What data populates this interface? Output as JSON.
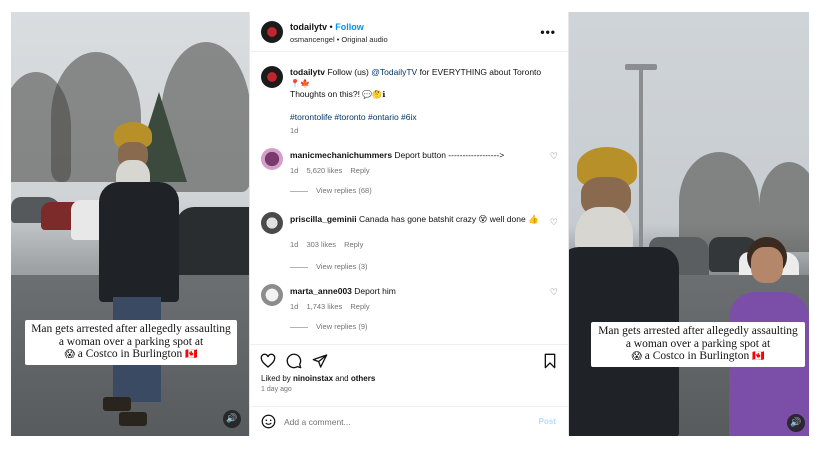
{
  "left_video": {
    "caption_text": "Man gets arrested after allegedly assaulting a woman over a parking spot at",
    "caption_emoji": "😱",
    "caption_text_2": "a Costco in Burlington",
    "caption_flag": "🇨🇦",
    "mute_icon": "speaker-icon"
  },
  "right_video": {
    "caption_text": "Man gets arrested after allegedly assaulting a woman over a parking spot at",
    "caption_emoji": "😱",
    "caption_text_2": "a Costco in Burlington",
    "caption_flag": "🇨🇦",
    "mute_icon": "speaker-icon"
  },
  "post": {
    "header": {
      "username": "todailytv",
      "separator": "•",
      "follow_label": "Follow",
      "audio": "osmancengel • Original audio",
      "more": "•••"
    },
    "caption": {
      "username": "todailytv",
      "text_before_mention": " Follow (us) ",
      "mention": "@TodailyTV",
      "text_after_mention": " for EVERYTHING about Toronto",
      "emojis_line": "📍🍁",
      "question": "Thoughts on this?!",
      "question_emojis": "💬🤔ℹ",
      "hashtags": "#torontolife #toronto #ontario #6ix",
      "time": "1d"
    },
    "comments": [
      {
        "username": "manicmechanichummers",
        "text": "Deport button ------------------>",
        "time": "1d",
        "likes": "5,620 likes",
        "reply": "Reply",
        "view_replies": "View replies (68)"
      },
      {
        "username": "priscilla_geminii",
        "text": "Canada has gone batshit crazy 😵 well done 👍",
        "time": "1d",
        "likes": "303 likes",
        "reply": "Reply",
        "view_replies": "View replies (3)"
      },
      {
        "username": "marta_anne003",
        "text": "Deport him",
        "time": "1d",
        "likes": "1,743 likes",
        "reply": "Reply",
        "view_replies": "View replies (9)"
      }
    ],
    "liked_by_prefix": "Liked by ",
    "liked_by_user": "ninoinstax",
    "liked_by_and": " and ",
    "liked_by_others": "others",
    "date": "1 day ago",
    "comment_placeholder": "Add a comment...",
    "post_button": "Post"
  },
  "icons": {
    "heart": "heart-icon",
    "comment": "comment-icon",
    "share": "share-icon",
    "bookmark": "bookmark-icon",
    "emoji": "emoji-icon",
    "more": "more-icon",
    "mute": "speaker-icon"
  },
  "colors": {
    "follow": "#0095f6",
    "hashtag": "#00376b",
    "muted_text": "#737373",
    "post_disabled": "#b3dbff"
  }
}
